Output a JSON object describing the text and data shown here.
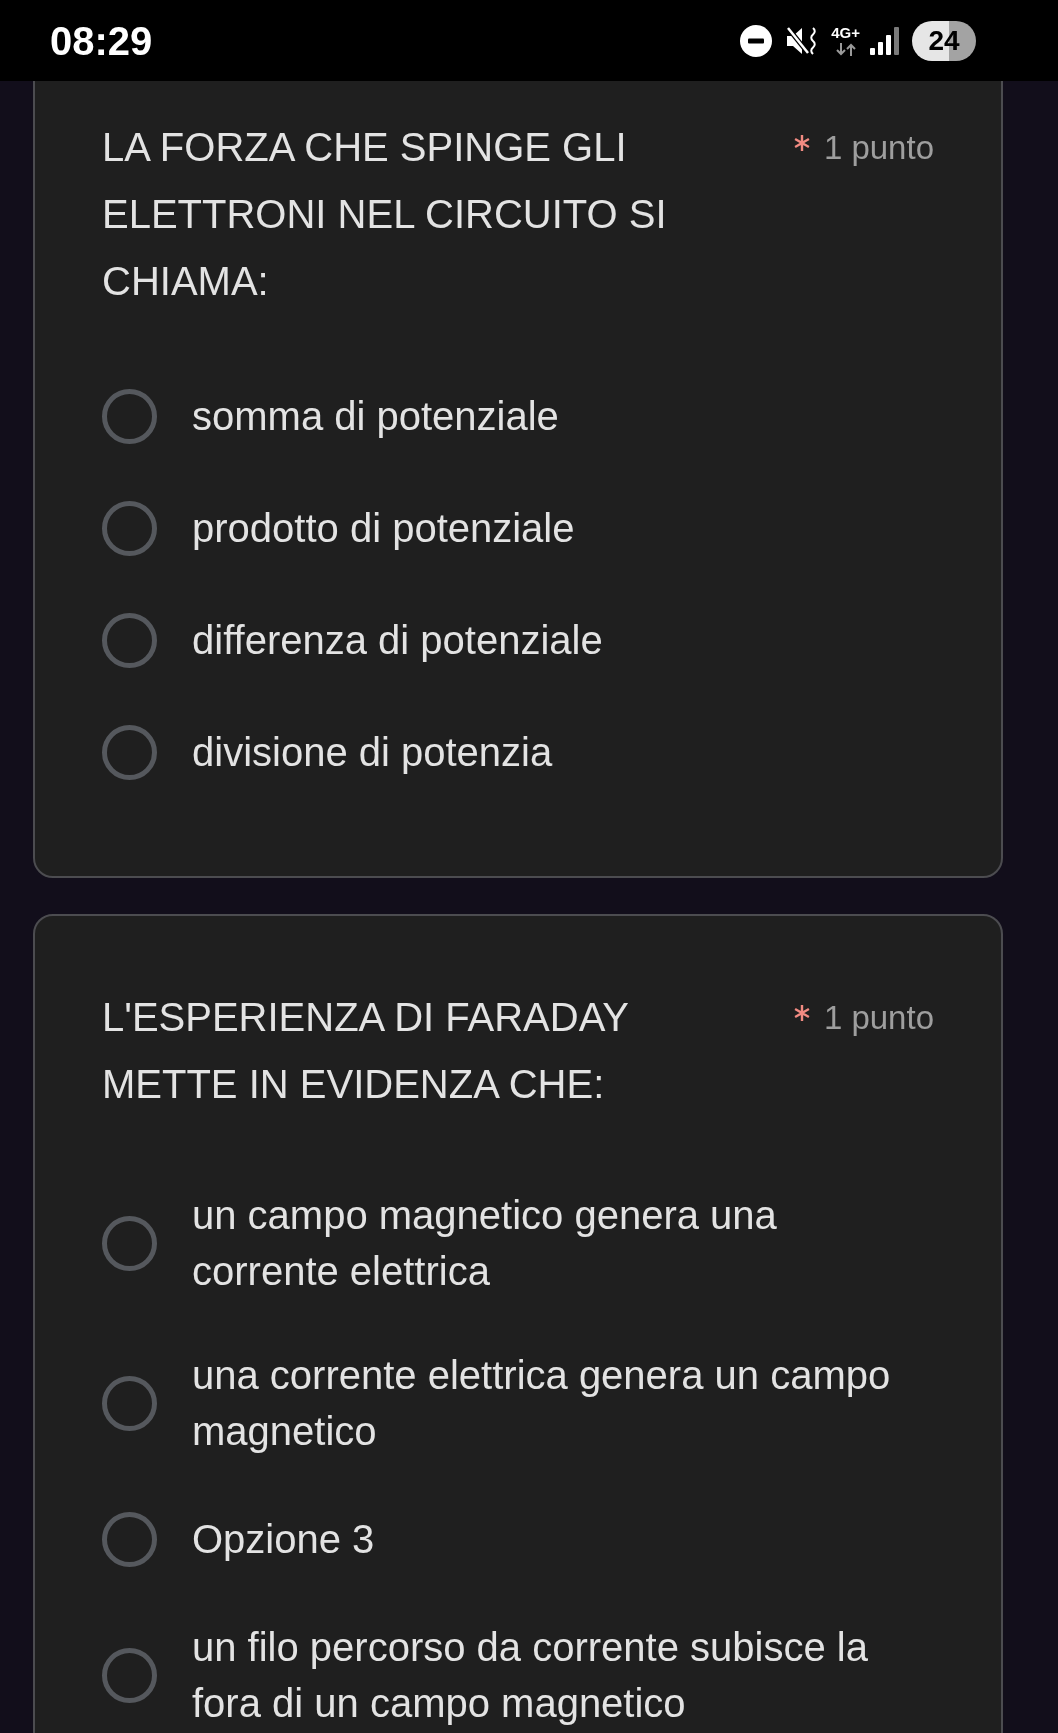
{
  "status_bar": {
    "time": "08:29",
    "network": "4G+",
    "battery": "24"
  },
  "questions": [
    {
      "title": "LA FORZA CHE SPINGE GLI ELETTRONI NEL CIRCUITO SI CHIAMA:",
      "required": true,
      "points": "1 punto",
      "options": [
        {
          "label": "somma di potenziale",
          "selected": false
        },
        {
          "label": "prodotto di potenziale",
          "selected": false
        },
        {
          "label": "differenza di potenziale",
          "selected": false
        },
        {
          "label": "divisione di potenzia",
          "selected": false
        }
      ]
    },
    {
      "title": "L'ESPERIENZA DI FARADAY METTE IN EVIDENZA CHE:",
      "required": true,
      "points": "1 punto",
      "options": [
        {
          "label": "un campo magnetico genera una corrente elettrica",
          "selected": false
        },
        {
          "label": "una corrente elettrica genera un campo magnetico",
          "selected": false
        },
        {
          "label": "Opzione 3",
          "selected": false
        },
        {
          "label": "un filo percorso da corrente subisce la fora di un campo magnetico",
          "selected": false
        }
      ]
    }
  ]
}
